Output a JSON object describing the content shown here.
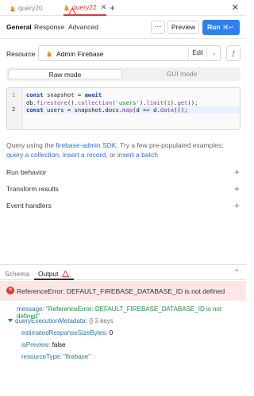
{
  "tabs": [
    {
      "label": "query20"
    },
    {
      "label": "query22"
    }
  ],
  "toolbar": {
    "general": "General",
    "response": "Response",
    "advanced": "Advanced",
    "more": "···",
    "preview": "Preview",
    "run": "Run",
    "run_shortcut": "⌘↵"
  },
  "resource": {
    "label": "Resource",
    "name": "Admin Firebase",
    "edit": "Edit",
    "fx": "ƒ"
  },
  "modes": {
    "raw": "Raw mode",
    "gui": "GUI mode"
  },
  "editor": {
    "line_numbers": [
      "1",
      "2"
    ],
    "line1_kw": "const",
    "line1_rest": " snapshot = ",
    "line1_kw2": "await",
    "line2_pre": "db.",
    "line2_fn1": "firestore",
    "line2_mid1": "().",
    "line2_fn2": "collection",
    "line2_mid2": "(",
    "line2_str": "'users'",
    "line2_mid3": ").",
    "line2_fn3": "limit",
    "line2_mid4": "(",
    "line2_num": "1",
    "line2_mid5": ").",
    "line2_fn4": "get",
    "line2_end": "();",
    "line3_kw": "const",
    "line3_rest1": " users = snapshot.docs.",
    "line3_fn1": "map",
    "line3_rest2": "(d => d.",
    "line3_fn2": "data",
    "line3_end": "());"
  },
  "helper": {
    "prefix": "Query using the ",
    "sdk_link": "firebase-admin SDK",
    "middle": ". Try a few pre-populated examples:",
    "ex1": "query a collection",
    "sep1": ", ",
    "ex2": "insert a record",
    "sep2": ", or ",
    "ex3": "insert a batch"
  },
  "sections": {
    "run_behavior": "Run behavior",
    "transform_results": "Transform results",
    "event_handlers": "Event handlers"
  },
  "bottom": {
    "schema_tab": "Schema",
    "output_tab": "Output"
  },
  "error": {
    "text": "ReferenceError: DEFAULT_FIREBASE_DATABASE_ID is not defined"
  },
  "output": {
    "message_key": "message:",
    "message_val": "\"ReferenceError: DEFAULT_FIREBASE_DATABASE_ID is not defined\"",
    "meta_key": "queryExecutionMetadata:",
    "meta_summary": "{} 3 keys",
    "est_key": "estimatedResponseSizeBytes:",
    "est_val": "0",
    "preview_key": "isPreview:",
    "preview_val": "false",
    "type_key": "resourceType:",
    "type_val": "\"firebase\""
  },
  "colors": {
    "accent": "#2f80ed",
    "error": "#d83a34",
    "error_bg": "#fde7e6",
    "firebase": "#f5820d"
  }
}
